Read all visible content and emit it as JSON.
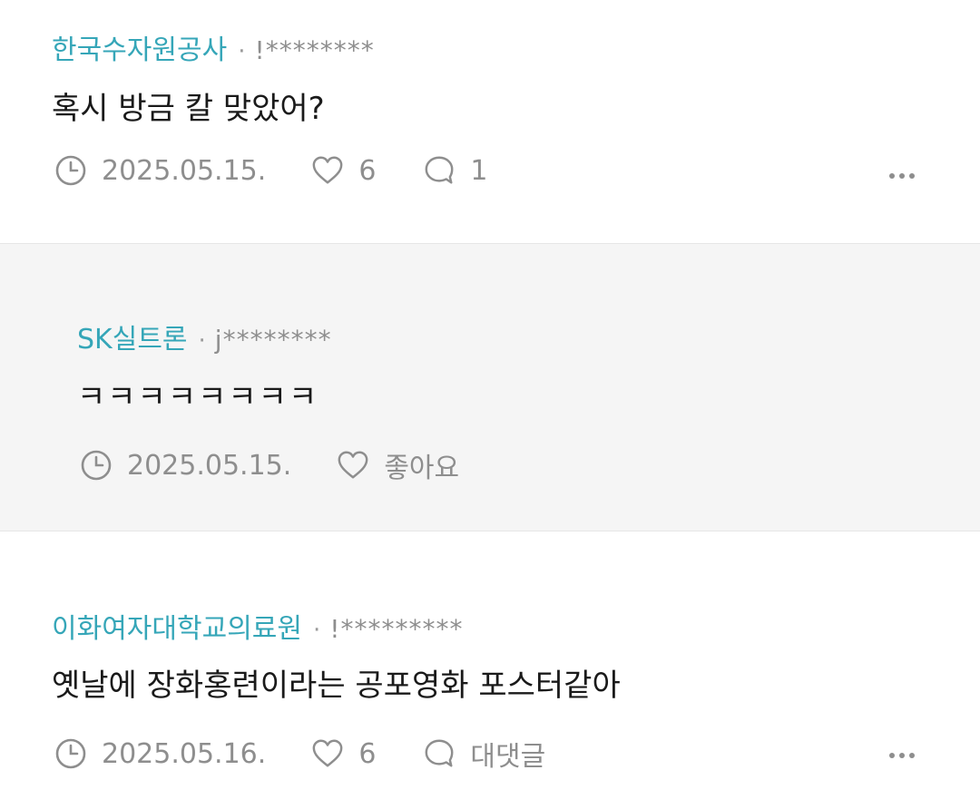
{
  "comments": [
    {
      "company": "한국수자원공사",
      "separator": "·",
      "user": "!********",
      "text": "혹시 방금 칼 맞았어?",
      "date": "2025.05.15.",
      "likes": "6",
      "replies": "1"
    },
    {
      "company": "SK실트론",
      "separator": "·",
      "user": "j********",
      "text": "ㅋㅋㅋㅋㅋㅋㅋㅋ",
      "date": "2025.05.15.",
      "like_label": "좋아요"
    },
    {
      "company": "이화여자대학교의료원",
      "separator": "·",
      "user": "!*********",
      "text": "옛날에 장화홍련이라는 공포영화 포스터같아",
      "date": "2025.05.16.",
      "likes": "6",
      "reply_label": "대댓글"
    }
  ],
  "colors": {
    "company": "#35a6b8",
    "meta": "#8e8e8e",
    "reply_background": "#f5f5f5"
  },
  "icons": [
    "clock-icon",
    "heart-icon",
    "comment-bubble-icon",
    "more-options-icon"
  ]
}
